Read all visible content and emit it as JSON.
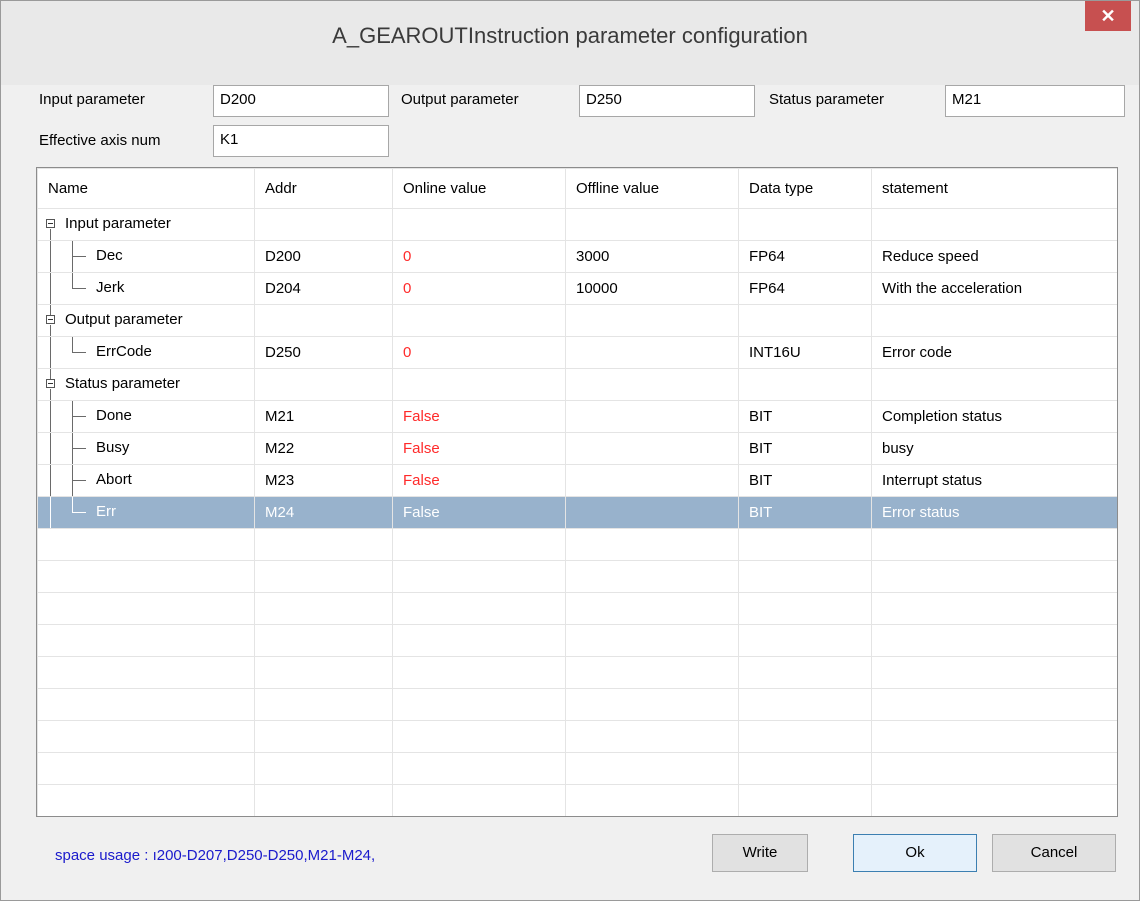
{
  "window": {
    "title": "A_GEAROUTInstruction parameter configuration",
    "close_glyph": "✕"
  },
  "form": {
    "input_param_label": "Input parameter",
    "input_param_value": "D200",
    "output_param_label": "Output parameter",
    "output_param_value": "D250",
    "status_param_label": "Status parameter",
    "status_param_value": "M21",
    "axis_label": "Effective axis num",
    "axis_value": "K1"
  },
  "grid": {
    "columns": [
      "Name",
      "Addr",
      "Online value",
      "Offline value",
      "Data type",
      "statement"
    ],
    "groups": [
      {
        "name": "Input parameter",
        "rows": [
          {
            "name": "Dec",
            "addr": "D200",
            "online": "0",
            "offline": "3000",
            "type": "FP64",
            "statement": "Reduce speed"
          },
          {
            "name": "Jerk",
            "addr": "D204",
            "online": "0",
            "offline": "10000",
            "type": "FP64",
            "statement": "With the acceleration"
          }
        ]
      },
      {
        "name": "Output parameter",
        "rows": [
          {
            "name": "ErrCode",
            "addr": "D250",
            "online": "0",
            "offline": "",
            "type": "INT16U",
            "statement": "Error code"
          }
        ]
      },
      {
        "name": "Status parameter",
        "rows": [
          {
            "name": "Done",
            "addr": "M21",
            "online": "False",
            "offline": "",
            "type": "BIT",
            "statement": "Completion status"
          },
          {
            "name": "Busy",
            "addr": "M22",
            "online": "False",
            "offline": "",
            "type": "BIT",
            "statement": "busy"
          },
          {
            "name": "Abort",
            "addr": "M23",
            "online": "False",
            "offline": "",
            "type": "BIT",
            "statement": "Interrupt status"
          },
          {
            "name": "Err",
            "addr": "M24",
            "online": "False",
            "offline": "",
            "type": "BIT",
            "statement": "Error status",
            "selected": true
          }
        ]
      }
    ]
  },
  "footer": {
    "space_usage": "space usage : ı200-D207,D250-D250,M21-M24,",
    "write_label": "Write",
    "ok_label": "Ok",
    "cancel_label": "Cancel"
  },
  "colors": {
    "online_value": "#ff2a2a",
    "selection": "#98b2cc",
    "close_button": "#c75050",
    "status_text": "#1a1acc"
  }
}
